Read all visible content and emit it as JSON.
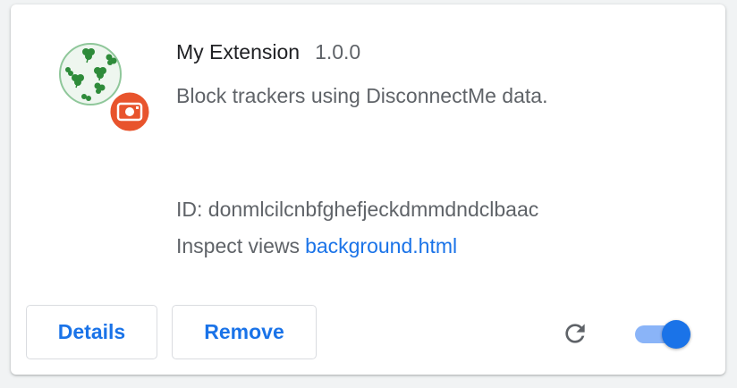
{
  "extension": {
    "name": "My Extension",
    "version": "1.0.0",
    "description": "Block trackers using DisconnectMe data.",
    "id_text": "ID: donmlcilcnbfghefjeckdmmdndclbaac",
    "inspect_label": "Inspect views",
    "inspect_link": "background.html",
    "enabled": true
  },
  "actions": {
    "details_label": "Details",
    "remove_label": "Remove"
  },
  "icons": {
    "extension": "shamrock-extension-icon",
    "badge": "camera-badge-icon",
    "reload": "reload-icon"
  },
  "colors": {
    "accent": "#1a73e8",
    "toggle_track": "#8ab4f8",
    "badge": "#e8542d",
    "icon_green": "#2e8b3a"
  }
}
